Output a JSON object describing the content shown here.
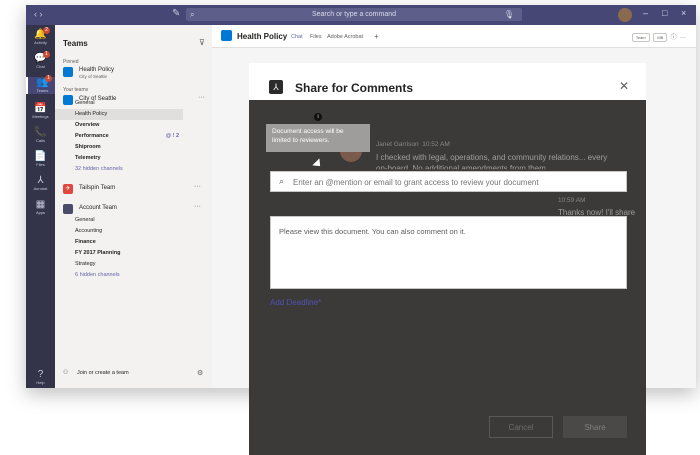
{
  "topbar": {
    "search_placeholder": "Search or type a command",
    "back_forward": "‹  ›",
    "compose_glyph": "✎",
    "window_controls": [
      "–",
      "□",
      "×"
    ]
  },
  "rail": {
    "items": [
      {
        "icon": "🔔",
        "label": "Activity",
        "badge": "2"
      },
      {
        "icon": "💬",
        "label": "Chat",
        "badge": "1"
      },
      {
        "icon": "👥",
        "label": "Teams",
        "badge": "1"
      },
      {
        "icon": "📅",
        "label": "Meetings",
        "badge": ""
      },
      {
        "icon": "📞",
        "label": "Calls",
        "badge": ""
      },
      {
        "icon": "📄",
        "label": "Files",
        "badge": ""
      },
      {
        "icon": "⅄",
        "label": "Acrobat",
        "badge": ""
      },
      {
        "icon": "▦",
        "label": "Apps",
        "badge": ""
      },
      {
        "icon": "?",
        "label": "Help",
        "badge": ""
      }
    ]
  },
  "teams_pane": {
    "title": "Teams",
    "pinned_label": "Pinned",
    "pinned_team": {
      "name": "Health Policy",
      "sub": "City of Seattle"
    },
    "your_teams_label": "Your teams",
    "city_team": {
      "name": "City of Seattle"
    },
    "city_channels": [
      "General",
      "Health Policy",
      "Overview",
      "Performance",
      "Shiproom",
      "Telemetry",
      "32 hidden channels"
    ],
    "performance_mentions": "@ ! 2",
    "tailspin_team": {
      "name": "Tailspin Team"
    },
    "account_team": {
      "name": "Account Team"
    },
    "account_channels": [
      "General",
      "Accounting",
      "Finance",
      "FY 2017 Planning",
      "Strategy",
      "6 hidden channels"
    ],
    "join_label": "Join or create a team"
  },
  "chat": {
    "title": "Health Policy",
    "tabs": [
      "Chat",
      "Files",
      "Adobe Acrobat",
      "+"
    ],
    "right_pills": [
      "Team",
      "MB"
    ]
  },
  "background_messages": {
    "sender": "Janet Garrison",
    "time": "10:52 AM",
    "line1": "I checked with legal, operations, and community relations... every",
    "line2": "on-board. No additional amendments from them.",
    "time2": "10:59 AM",
    "reply": "Thanks now! I'll share"
  },
  "modal": {
    "title": "Share for Comments",
    "tooltip": "Document access will be limited to reviewers.",
    "mention_placeholder": "Enter an @mention or email to grant access to review your document",
    "comment_text": "Please view this document. You can also comment on it.",
    "deadline_link": "Add Deadline*",
    "cancel_label": "Cancel",
    "share_label": "Share"
  },
  "colors": {
    "teams_purple": "#464775",
    "rail_dark": "#33344a",
    "link_purple": "#6264a7",
    "modal_dark": "#3b3a39",
    "deadline_blue": "#4f52b2",
    "badge_red": "#cc4a31"
  }
}
